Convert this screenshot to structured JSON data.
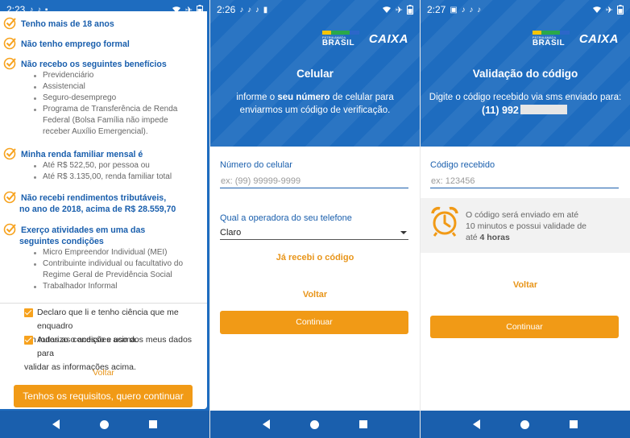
{
  "phone1": {
    "status": {
      "time": "2:23"
    },
    "requirements": [
      {
        "title": "Tenho mais de 18 anos",
        "items": []
      },
      {
        "title": "Não tenho emprego formal",
        "items": []
      },
      {
        "title": "Não recebo os seguintes benefícios",
        "items": [
          "Previdenciário",
          "Assistencial",
          "Seguro-desemprego",
          "Programa de Transferência de Renda",
          "Federal (Bolsa Família não impede",
          "receber Auxílio Emergencial)."
        ]
      },
      {
        "title": "Minha renda familiar mensal é",
        "items": [
          "Até R$ 522,50, por pessoa ou",
          "Até R$ 3.135,00, renda familiar total"
        ]
      },
      {
        "title": "Não recebi rendimentos tributáveis,",
        "title2": "no ano de 2018, acima de R$ 28.559,70",
        "items": []
      },
      {
        "title": "Exerço atividades em uma das",
        "title2": "seguintes condições",
        "items": [
          "Micro Empreendor Individual (MEI)",
          "Contribuinte individual ou facultativo do",
          "Regime Geral de Previdência Social",
          "Trabalhador Informal"
        ]
      }
    ],
    "checkbox1": {
      "line1": "Declaro que li e tenho ciência que me enquadro",
      "line2": "em todas as condições acima."
    },
    "checkbox2": {
      "line1": "Autorizo o acesso e uso dos meus dados para",
      "line2": "validar as informações acima."
    },
    "back_link": "Voltar",
    "continue_button": "Tenhos os requisitos, quero continuar"
  },
  "phone2": {
    "status": {
      "time": "2:26"
    },
    "logo_brasil_small": "PÁTRIA AMADA",
    "logo_brasil": "BRASIL",
    "logo_caixa": "CAIXA",
    "title": "Celular",
    "desc_pre": "informe o ",
    "desc_bold": "seu número",
    "desc_post": " de celular para",
    "desc_line2": "enviarmos um código de verificação.",
    "phone_label": "Número do celular",
    "phone_placeholder": "ex: (99) 99999-9999",
    "operator_label": "Qual a operadora do seu telefone",
    "operator_value": "Claro",
    "have_code_link": "Já recebi o código",
    "back_link": "Voltar",
    "continue_button": "Continuar"
  },
  "phone3": {
    "status": {
      "time": "2:27"
    },
    "logo_brasil_small": "PÁTRIA AMADA",
    "logo_brasil": "BRASIL",
    "logo_caixa": "CAIXA",
    "title": "Validação do código",
    "desc_line1": "Digite o código recebido via sms enviado para:",
    "desc_phone": "(11) 992",
    "code_label": "Código recebido",
    "code_placeholder": "ex: 123456",
    "info_line1": "O código será enviado em até",
    "info_line2": "10 minutos e possui validade de",
    "info_pre": "até ",
    "info_bold": "4 horas",
    "back_link": "Voltar",
    "continue_button": "Continuar"
  },
  "colors": {
    "primary": "#1e6cbf",
    "accent": "#f19a16",
    "nav": "#1a5fad"
  },
  "icons": [
    "check-circle-icon",
    "checkbox-icon",
    "alarm-clock-icon",
    "wifi-icon",
    "airplane-icon",
    "battery-icon",
    "tiktok-icon"
  ]
}
